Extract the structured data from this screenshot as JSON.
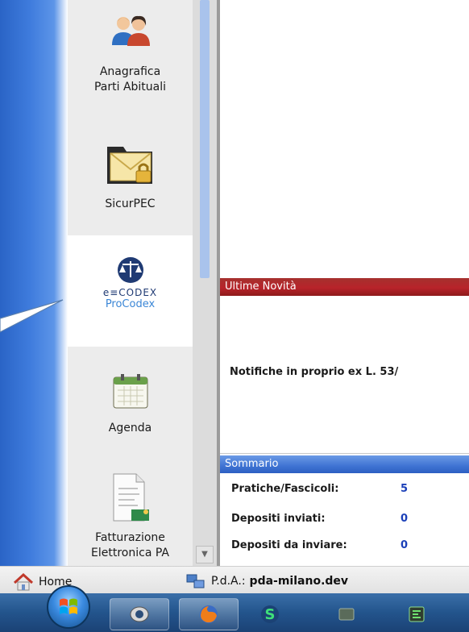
{
  "sidebar": {
    "items": [
      {
        "label": "Anagrafica\nParti Abituali",
        "icon": "contacts-people-icon"
      },
      {
        "label": "SicurPEC",
        "icon": "secure-mail-lock-icon"
      },
      {
        "logo_text_1": "e≡CODEX",
        "logo_text_2": "ProCodex",
        "icon": "ecodex-justice-icon",
        "active": true
      },
      {
        "label": "Agenda",
        "icon": "calendar-icon"
      },
      {
        "label": "Fatturazione\nElettronica PA",
        "icon": "invoice-document-icon"
      }
    ]
  },
  "news": {
    "header": "Ultime Novità",
    "item": "Notifiche in proprio ex L. 53/"
  },
  "summary": {
    "header": "Sommario",
    "rows": [
      {
        "label": "Pratiche/Fascicoli:",
        "value": "5"
      },
      {
        "label": "Depositi inviati:",
        "value": "0"
      },
      {
        "label": "Depositi da inviare:",
        "value": "0"
      }
    ]
  },
  "statusbar": {
    "home_label": "Home",
    "pda_prefix": "P.d.A.:",
    "pda_value": "pda-milano.dev"
  },
  "taskbar": {
    "items": [
      "start-orb",
      "webcam-app-icon",
      "firefox-icon",
      "skype-s-icon",
      "window-app-icon",
      "terminal-app-icon"
    ]
  },
  "colors": {
    "news_header": "#b8232a",
    "summary_header": "#3f73d3",
    "summary_value": "#1a3fb8",
    "taskbar": "#23548c"
  }
}
